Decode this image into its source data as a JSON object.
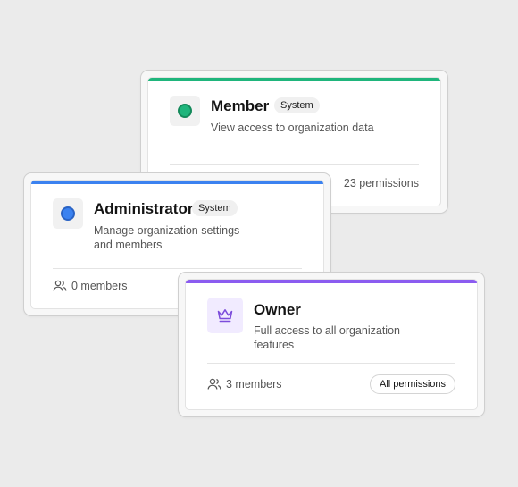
{
  "roles": {
    "member": {
      "name": "Member",
      "badge": "System",
      "description": "View access to organization data",
      "permissions": "23 permissions",
      "accent": "#1fb57c",
      "icon": "status-dot-green"
    },
    "administrator": {
      "name": "Administrator",
      "badge": "System",
      "description_line1": "Manage organization settings",
      "description_line2": "and members",
      "members": "0 members",
      "accent": "#3b82f0",
      "icon": "status-dot-blue"
    },
    "owner": {
      "name": "Owner",
      "description_line1": "Full access to all organization",
      "description_line2": "features",
      "members": "3 members",
      "permissions_button": "All permissions",
      "accent": "#8b5cf0",
      "icon": "crown-icon"
    }
  }
}
